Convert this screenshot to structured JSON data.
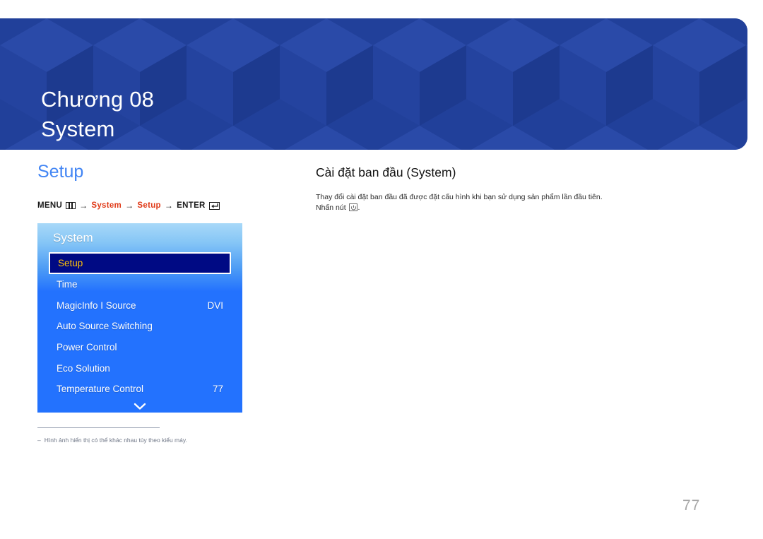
{
  "banner": {
    "chapter": "Chương 08",
    "title": "System",
    "bg_color": "#21409a"
  },
  "left": {
    "section_title": "Setup",
    "accent_color": "#4285f4",
    "menu_path": {
      "menu_label": "MENU",
      "menu_icon": "menu-bars-icon",
      "arrow": "→",
      "step1": "System",
      "step2": "Setup",
      "enter_label": "ENTER",
      "enter_icon": "enter-return-icon",
      "highlight_color": "#e03a18"
    },
    "osd": {
      "title": "System",
      "scroll_icon": "chevron-down-icon",
      "items": [
        {
          "label": "Setup",
          "value": "",
          "selected": true
        },
        {
          "label": "Time",
          "value": "",
          "selected": false
        },
        {
          "label": "MagicInfo I Source",
          "value": "DVI",
          "selected": false
        },
        {
          "label": "Auto Source Switching",
          "value": "",
          "selected": false
        },
        {
          "label": "Power Control",
          "value": "",
          "selected": false
        },
        {
          "label": "Eco Solution",
          "value": "",
          "selected": false
        },
        {
          "label": "Temperature Control",
          "value": "77",
          "selected": false
        }
      ],
      "selected_text_color": "#ffc20e",
      "selected_bg_color": "#000a84"
    },
    "footnote": {
      "dash": "‒",
      "text": "Hình ảnh hiển thị có thể khác nhau tùy theo kiểu máy."
    }
  },
  "right": {
    "title": "Cài đặt ban đầu (System)",
    "body_line1": "Thay đổi cài đặt ban đầu đã được đặt cấu hình khi bạn sử dụng sản phẩm lần đầu tiên.",
    "body_line2_prefix": "Nhấn nút",
    "body_line2_icon": "power-button-icon",
    "body_line2_suffix": "."
  },
  "page_number": "77"
}
